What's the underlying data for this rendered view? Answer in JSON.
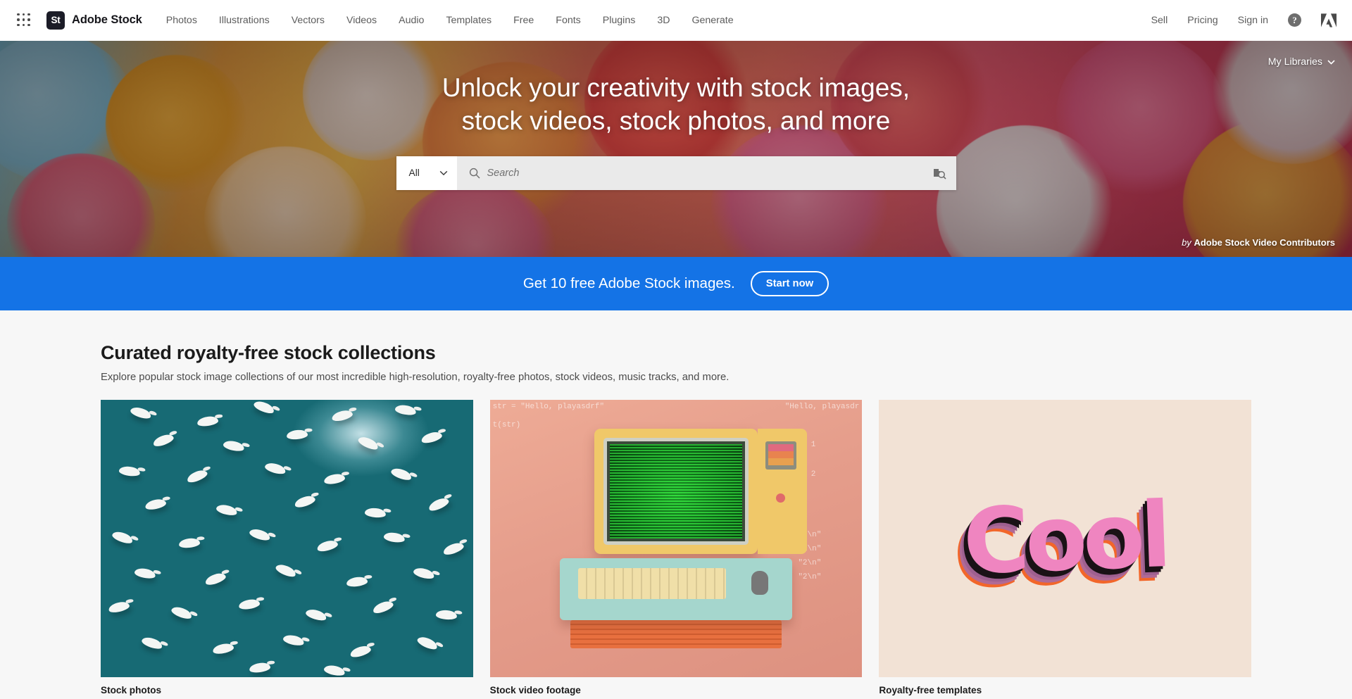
{
  "topnav": {
    "app_grid_icon": "app-grid-icon",
    "brand": {
      "badge": "St",
      "name": "Adobe Stock"
    },
    "links": [
      {
        "label": "Photos"
      },
      {
        "label": "Illustrations"
      },
      {
        "label": "Vectors"
      },
      {
        "label": "Videos"
      },
      {
        "label": "Audio"
      },
      {
        "label": "Templates"
      },
      {
        "label": "Free"
      },
      {
        "label": "Fonts"
      },
      {
        "label": "Plugins"
      },
      {
        "label": "3D"
      },
      {
        "label": "Generate"
      }
    ],
    "right_links": [
      {
        "label": "Sell"
      },
      {
        "label": "Pricing"
      },
      {
        "label": "Sign in"
      }
    ],
    "help_icon": "?",
    "adobe_logo_icon": "adobe-logo-icon"
  },
  "hero": {
    "my_libraries": "My Libraries",
    "chevron": "⌄",
    "title_line1": "Unlock your creativity with stock images,",
    "title_line2": "stock videos, stock photos, and more",
    "search": {
      "category": "All",
      "placeholder": "Search",
      "search_icon": "search-icon",
      "visual_search_icon": "visual-search-icon",
      "chevron_icon": "chevron-down-icon"
    },
    "attribution_prefix": "by",
    "attribution_name": "Adobe Stock Video Contributors"
  },
  "promo": {
    "text": "Get 10 free Adobe Stock images.",
    "button": "Start now",
    "bg_color": "#1473E6"
  },
  "main": {
    "section_title": "Curated royalty-free stock collections",
    "section_subtitle": "Explore popular stock image collections of our most incredible high-resolution, royalty-free photos, stock videos, music tracks, and more.",
    "cards": [
      {
        "label": "Stock photos",
        "art": "aerial-white-swans-on-teal-water"
      },
      {
        "label": "Stock video footage",
        "art": "retro-computer-with-green-code-screen"
      },
      {
        "label": "Royalty-free templates",
        "art": "3d-pink-cool-typography"
      }
    ],
    "card3_word": "Cool",
    "card2_code_lines": [
      "str = \"Hello, playasdrf\"",
      "t(str)",
      "\"Hello, playasdr",
      "1",
      "2",
      "\"3\\n\"",
      "\"1\\n\"",
      "\"2\\n\"",
      "\"2\\n\""
    ]
  },
  "colors": {
    "accent_blue": "#1473E6",
    "page_bg": "#f7f7f7",
    "nav_text": "#5c5c5c",
    "swan_water": "#176a74"
  }
}
